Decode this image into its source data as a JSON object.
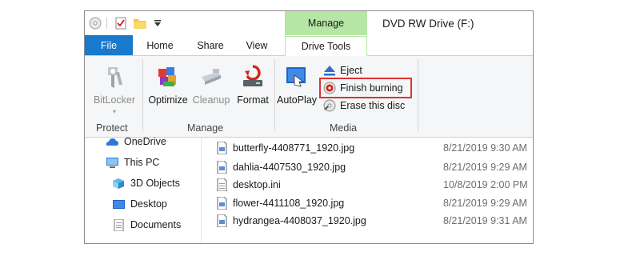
{
  "title_bar": {
    "manage_label": "Manage",
    "window_title": "DVD RW Drive (F:)"
  },
  "tabs": [
    {
      "label": "File"
    },
    {
      "label": "Home"
    },
    {
      "label": "Share"
    },
    {
      "label": "View"
    },
    {
      "label": "Drive Tools"
    }
  ],
  "ribbon": {
    "protect": {
      "label": "Protect",
      "bitlocker": "BitLocker"
    },
    "manage": {
      "label": "Manage",
      "optimize": "Optimize",
      "cleanup": "Cleanup",
      "format": "Format"
    },
    "media": {
      "label": "Media",
      "autoplay": "AutoPlay",
      "eject": "Eject",
      "finish_burning": "Finish burning",
      "erase": "Erase this disc"
    }
  },
  "nav": {
    "items": [
      {
        "label": "OneDrive"
      },
      {
        "label": "This PC"
      },
      {
        "label": "3D Objects"
      },
      {
        "label": "Desktop"
      },
      {
        "label": "Documents"
      }
    ]
  },
  "files": [
    {
      "name": "butterfly-4408771_1920.jpg",
      "date": "8/21/2019 9:30 AM"
    },
    {
      "name": "dahlia-4407530_1920.jpg",
      "date": "8/21/2019 9:29 AM"
    },
    {
      "name": "desktop.ini",
      "date": "10/8/2019 2:00 PM"
    },
    {
      "name": "flower-4411108_1920.jpg",
      "date": "8/21/2019 9:29 AM"
    },
    {
      "name": "hydrangea-4408037_1920.jpg",
      "date": "8/21/2019 9:31 AM"
    }
  ],
  "colors": {
    "file_tab": "#1979ca",
    "manage_band": "#b6e6a6",
    "highlight": "#e03232"
  }
}
